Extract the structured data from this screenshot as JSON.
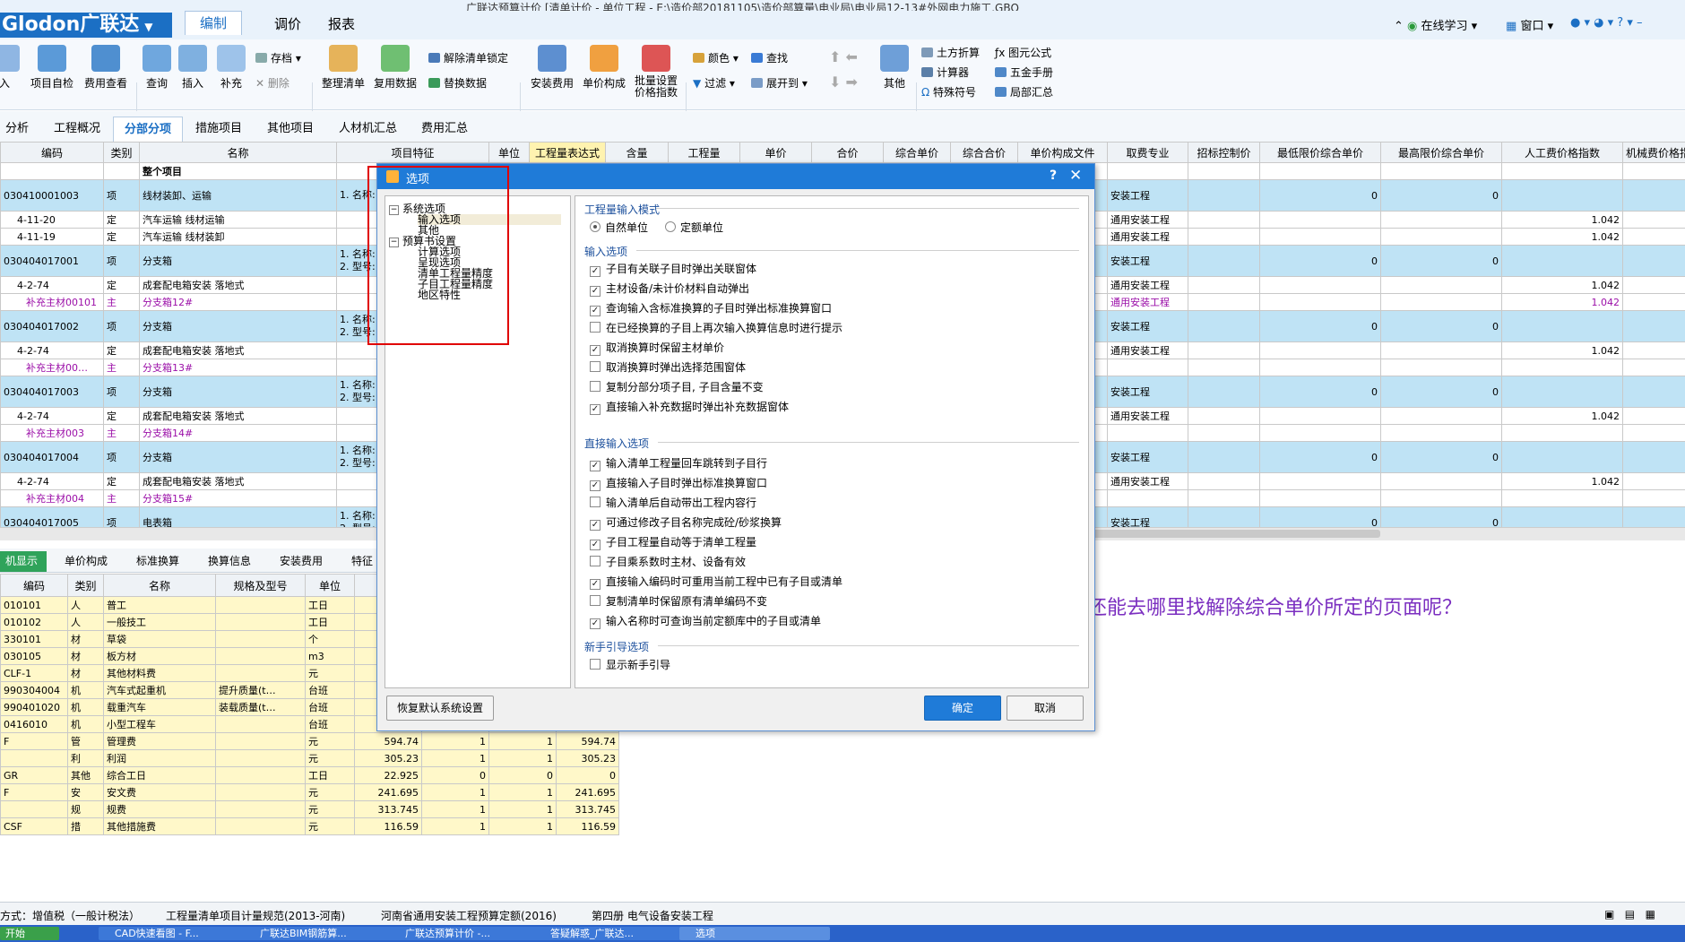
{
  "app": {
    "brand": "Glodon广联达",
    "title_text": "广联达预算计价   [清单计价 - 单位工程 - E:\\造价部20181105\\造价部算量\\电业局\\电业局12-13#外网电力施工.GBQ",
    "menu_tabs": [
      "编制",
      "调价",
      "报表"
    ],
    "right_items": [
      "在线学习",
      "窗口"
    ]
  },
  "ribbon": {
    "big": [
      "入",
      "项目自检",
      "费用查看",
      "查询",
      "插入",
      "补充",
      "整理清单",
      "复用数据",
      "安装费用",
      "单价构成",
      "批量设置价格指数",
      "其他"
    ],
    "small": [
      "存档",
      "删除",
      "解除清单锁定",
      "替换数据",
      "颜色",
      "查找",
      "过滤",
      "展开到",
      "土方折算",
      "计算器",
      "特殊符号",
      "图元公式",
      "五金手册",
      "局部汇总"
    ]
  },
  "tabs": [
    "分析",
    "工程概况",
    "分部分项",
    "措施项目",
    "其他项目",
    "人材机汇总",
    "费用汇总"
  ],
  "grid": {
    "headers": [
      "编码",
      "类别",
      "名称",
      "项目特征",
      "单位",
      "工程量表达式",
      "含量",
      "工程量",
      "单价",
      "合价",
      "综合单价",
      "综合合价",
      "单价构成文件",
      "取费专业",
      "招标控制价",
      "最低限价综合单价",
      "最高限价综合单价",
      "人工费价格指数",
      "机械费价格指数"
    ],
    "rows": [
      {
        "code": "",
        "type": "",
        "name": "整个项目",
        "feat": "",
        "fee": "",
        "lo": "",
        "hi": "",
        "idx": "",
        "kind": "head"
      },
      {
        "code": "030410001003",
        "type": "项",
        "name": "线材装卸、运输",
        "feat": "1. 名称:",
        "fee": "安装工程",
        "lo": "0",
        "hi": "0",
        "idx": "",
        "kind": "big"
      },
      {
        "code": "4-11-20",
        "type": "定",
        "name": "汽车运输 线材运输",
        "feat": "",
        "fee": "通用安装工程",
        "lo": "",
        "hi": "",
        "idx": "1.042",
        "kind": "norm"
      },
      {
        "code": "4-11-19",
        "type": "定",
        "name": "汽车运输 线材装卸",
        "feat": "",
        "fee": "通用安装工程",
        "lo": "",
        "hi": "",
        "idx": "1.042",
        "kind": "norm"
      },
      {
        "code": "030404017001",
        "type": "项",
        "name": "分支箱",
        "feat": "1. 名称:\n2. 型号:",
        "fee": "安装工程",
        "lo": "0",
        "hi": "0",
        "idx": "",
        "kind": "big"
      },
      {
        "code": "4-2-74",
        "type": "定",
        "name": "成套配电箱安装 落地式",
        "feat": "",
        "fee": "通用安装工程",
        "lo": "",
        "hi": "",
        "idx": "1.042",
        "kind": "norm"
      },
      {
        "code": "补充主材00101",
        "type": "主",
        "name": "分支箱12#",
        "feat": "",
        "fee": "通用安装工程",
        "lo": "",
        "hi": "",
        "idx": "1.042",
        "kind": "purple"
      },
      {
        "code": "030404017002",
        "type": "项",
        "name": "分支箱",
        "feat": "1. 名称:\n2. 型号:",
        "fee": "安装工程",
        "lo": "0",
        "hi": "0",
        "idx": "",
        "kind": "big"
      },
      {
        "code": "4-2-74",
        "type": "定",
        "name": "成套配电箱安装 落地式",
        "feat": "",
        "fee": "通用安装工程",
        "lo": "",
        "hi": "",
        "idx": "1.042",
        "kind": "norm"
      },
      {
        "code": "补充主材00…",
        "type": "主",
        "name": "分支箱13#",
        "feat": "",
        "fee": "",
        "lo": "",
        "hi": "",
        "idx": "",
        "kind": "purple"
      },
      {
        "code": "030404017003",
        "type": "项",
        "name": "分支箱",
        "feat": "1. 名称:\n2. 型号:",
        "fee": "安装工程",
        "lo": "0",
        "hi": "0",
        "idx": "",
        "kind": "big"
      },
      {
        "code": "4-2-74",
        "type": "定",
        "name": "成套配电箱安装 落地式",
        "feat": "",
        "fee": "通用安装工程",
        "lo": "",
        "hi": "",
        "idx": "1.042",
        "kind": "norm"
      },
      {
        "code": "补充主材003",
        "type": "主",
        "name": "分支箱14#",
        "feat": "",
        "fee": "",
        "lo": "",
        "hi": "",
        "idx": "",
        "kind": "purple"
      },
      {
        "code": "030404017004",
        "type": "项",
        "name": "分支箱",
        "feat": "1. 名称:\n2. 型号:",
        "fee": "安装工程",
        "lo": "0",
        "hi": "0",
        "idx": "",
        "kind": "big"
      },
      {
        "code": "4-2-74",
        "type": "定",
        "name": "成套配电箱安装 落地式",
        "feat": "",
        "fee": "通用安装工程",
        "lo": "",
        "hi": "",
        "idx": "1.042",
        "kind": "norm"
      },
      {
        "code": "补充主材004",
        "type": "主",
        "name": "分支箱15#",
        "feat": "",
        "fee": "",
        "lo": "",
        "hi": "",
        "idx": "",
        "kind": "purple"
      },
      {
        "code": "030404017005",
        "type": "项",
        "name": "电表箱",
        "feat": "1. 名称:\n2. 型号:",
        "fee": "安装工程",
        "lo": "0",
        "hi": "0",
        "idx": "",
        "kind": "big"
      }
    ]
  },
  "lower_tabs": [
    "机显示",
    "单价构成",
    "标准换算",
    "换算信息",
    "安装费用",
    "特征"
  ],
  "lower": {
    "headers": [
      "编码",
      "类别",
      "名称",
      "规格及型号",
      "单位",
      "数",
      "",
      "",
      ""
    ],
    "rows": [
      [
        "010101",
        "人",
        "普工",
        "",
        "工日",
        "",
        "",
        "",
        ""
      ],
      [
        "010102",
        "人",
        "一般技工",
        "",
        "工日",
        "",
        "",
        "",
        ""
      ],
      [
        "330101",
        "材",
        "草袋",
        "",
        "个",
        "",
        "",
        "",
        ""
      ],
      [
        "030105",
        "材",
        "板方材",
        "",
        "m3",
        "",
        "",
        "",
        ""
      ],
      [
        "CLF-1",
        "材",
        "其他材料费",
        "",
        "元",
        "2",
        "",
        "",
        ""
      ],
      [
        "990304004",
        "机",
        "汽车式起重机",
        "提升质量(t…",
        "台班",
        "",
        "",
        "",
        ""
      ],
      [
        "990401020",
        "机",
        "载重汽车",
        "装载质量(t…",
        "台班",
        "",
        "",
        "",
        ""
      ],
      [
        "0416010",
        "机",
        "小型工程车",
        "",
        "台班",
        "",
        "",
        "",
        ""
      ],
      [
        "F",
        "管",
        "管理费",
        "",
        "元",
        "594.74",
        "1",
        "1",
        "594.74"
      ],
      [
        "",
        "利",
        "利润",
        "",
        "元",
        "305.23",
        "1",
        "1",
        "305.23"
      ],
      [
        "GR",
        "其他",
        "综合工日",
        "",
        "工日",
        "22.925",
        "0",
        "0",
        "0"
      ],
      [
        "F",
        "安",
        "安文费",
        "",
        "元",
        "241.695",
        "1",
        "1",
        "241.695"
      ],
      [
        "",
        "规",
        "规费",
        "",
        "元",
        "313.745",
        "1",
        "1",
        "313.745"
      ],
      [
        "CSF",
        "措",
        "其他措施费",
        "",
        "元",
        "116.59",
        "1",
        "1",
        "116.59"
      ]
    ]
  },
  "question": "这个选项里没有你截图的那些，还能去哪里找解除综合单价所定的页面呢？",
  "status": [
    "方式：增值税（一般计税法）",
    "工程量清单项目计量规范(2013-河南)",
    "河南省通用安装工程预算定额(2016)",
    "第四册 电气设备安装工程"
  ],
  "taskbar": [
    "开始",
    "CAD快速看图 - F...",
    "广联达BIM钢筋算...",
    "广联达预算计价 -...",
    "答疑解惑_广联达...",
    "选项"
  ],
  "dialog": {
    "title": "选项",
    "help": "?",
    "close": "✕",
    "tree": {
      "n1": "系统选项",
      "n1a": "输入选项",
      "n1b": "其他",
      "n2": "预算书设置",
      "n2a": "计算选项",
      "n2b": "呈现选项",
      "n2c": "清单工程量精度",
      "n2d": "子目工程量精度",
      "n2e": "地区特性"
    },
    "grp1": "工程量输入模式",
    "radio1": "自然单位",
    "radio2": "定额单位",
    "grp2": "输入选项",
    "input_opts": [
      {
        "label": "子目有关联子目时弹出关联窗体",
        "checked": true
      },
      {
        "label": "主材设备/未计价材料自动弹出",
        "checked": true
      },
      {
        "label": "查询输入含标准换算的子目时弹出标准换算窗口",
        "checked": true
      },
      {
        "label": "在已经换算的子目上再次输入换算信息时进行提示",
        "checked": false
      },
      {
        "label": "取消换算时保留主材单价",
        "checked": true
      },
      {
        "label": "取消换算时弹出选择范围窗体",
        "checked": false
      },
      {
        "label": "复制分部分项子目, 子目含量不变",
        "checked": false
      },
      {
        "label": "直接输入补充数据时弹出补充数据窗体",
        "checked": true
      }
    ],
    "grp3": "直接输入选项",
    "direct_opts": [
      {
        "label": "输入清单工程量回车跳转到子目行",
        "checked": true
      },
      {
        "label": "直接输入子目时弹出标准换算窗口",
        "checked": true
      },
      {
        "label": "输入清单后自动带出工程内容行",
        "checked": false
      },
      {
        "label": "可通过修改子目名称完成砼/砂浆换算",
        "checked": true
      },
      {
        "label": "子目工程量自动等于清单工程量",
        "checked": true
      },
      {
        "label": "子目乘系数时主材、设备有效",
        "checked": false
      },
      {
        "label": "直接输入编码时可重用当前工程中已有子目或清单",
        "checked": true
      },
      {
        "label": "复制清单时保留原有清单编码不变",
        "checked": false
      },
      {
        "label": "输入名称时可查询当前定额库中的子目或清单",
        "checked": true
      }
    ],
    "grp4": "新手引导选项",
    "guide": {
      "label": "显示新手引导",
      "checked": false
    },
    "restore": "恢复默认系统设置",
    "ok": "确定",
    "cancel": "取消"
  },
  "colors": {
    "accent": "#1f7bd8",
    "row_highlight": "#bfe3f5",
    "lower_bg": "#fff8c9",
    "annotation": "#7b2fc0",
    "box": "#e00000"
  }
}
